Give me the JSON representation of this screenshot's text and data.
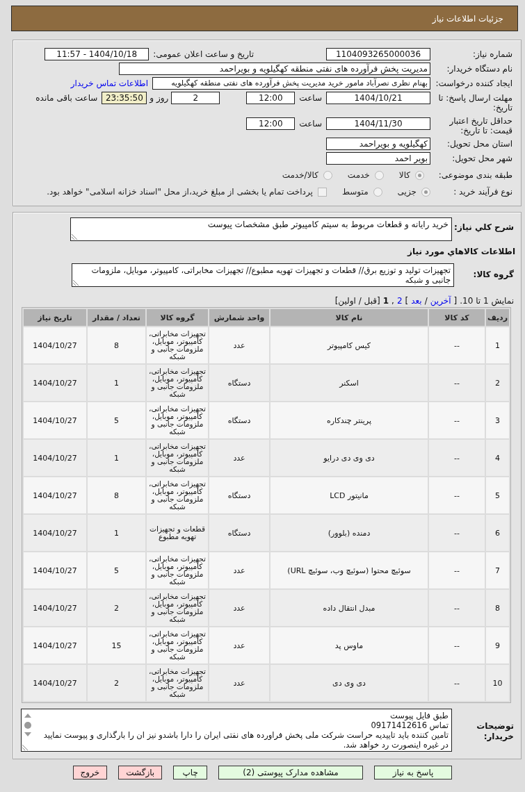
{
  "header": {
    "title": "جزئیات اطلاعات نیاز"
  },
  "details": {
    "need_number": {
      "label": "شماره نیاز:",
      "value": "1104093265000036"
    },
    "announce": {
      "label": "تاریخ و ساعت اعلان عمومی:",
      "value": "1404/10/18 - 11:57"
    },
    "buyer_org": {
      "label": "نام دستگاه خریدار:",
      "value": "مدیریت پخش فرآورده های نفتی منطقه کهگیلویه و بویراحمد"
    },
    "requester": {
      "label": "ایجاد کننده درخواست:",
      "value": "بهنام نظری نصرآباد مامور خرید مدیریت پخش فرآورده های نفتی منطقه کهگیلویه",
      "link": "اطلاعات تماس خریدار"
    },
    "reply_deadline": {
      "label": "مهلت ارسال پاسخ: تا تاریخ:",
      "date": "1404/10/21",
      "time_label": "ساعت",
      "time": "12:00",
      "days": "2",
      "days_label": "روز و",
      "remaining": "23:35:50",
      "remaining_label": "ساعت باقی مانده"
    },
    "price_validity": {
      "label": "حداقل تاریخ اعتبار قیمت: تا تاریخ:",
      "date": "1404/11/30",
      "time_label": "ساعت",
      "time": "12:00"
    },
    "province": {
      "label": "استان محل تحویل:",
      "value": "کهگیلویه و بویراحمد"
    },
    "city": {
      "label": "شهر محل تحویل:",
      "value": "بویر احمد"
    },
    "category": {
      "label": "طبقه بندی موضوعی:",
      "options": [
        {
          "label": "کالا",
          "selected": true
        },
        {
          "label": "خدمت",
          "selected": false
        },
        {
          "label": "کالا/خدمت",
          "selected": false
        }
      ]
    },
    "process": {
      "label": "نوع فرآیند خرید :",
      "options": [
        {
          "label": "جزیی",
          "selected": true
        },
        {
          "label": "متوسط",
          "selected": false
        }
      ],
      "treasury": {
        "checked": false,
        "text": "پرداخت تمام یا بخشی از مبلغ خرید،از محل \"اسناد خزانه اسلامی\" خواهد بود."
      }
    }
  },
  "description": {
    "label": "شرح كلي نياز:",
    "value": "خرید رایانه و قطعات مربوط به سیتم کامپیوتر طبق مشخصات پیوست"
  },
  "goods": {
    "title": "اطلاعات كالاهاي مورد نياز",
    "group_label": "گروه کالا:",
    "group_value": "تجهیزات تولید و توزیع برق// قطعات و تجهیزات تهویه مطبوع// تجهیزات مخابراتی، کامپیوتر، موبایل، ملزومات جانبی و شبکه",
    "pagination": [
      {
        "kind": "text",
        "text": "نمایش 1 تا 10."
      },
      {
        "kind": "text",
        "text": "["
      },
      {
        "kind": "link",
        "text": "آخرین"
      },
      {
        "kind": "text",
        "text": "/"
      },
      {
        "kind": "link",
        "text": "بعد"
      },
      {
        "kind": "text",
        "text": "]"
      },
      {
        "kind": "link",
        "text": "2"
      },
      {
        "kind": "text",
        "text": ","
      },
      {
        "kind": "current",
        "text": "1"
      },
      {
        "kind": "text",
        "text": "[قبل / اولین]"
      }
    ],
    "table": {
      "columns": [
        "ردیف",
        "کد کالا",
        "نام کالا",
        "واحد شمارش",
        "گروه کالا",
        "تعداد / مقدار",
        "تاریخ نیاز"
      ],
      "rows": [
        [
          "1",
          "--",
          "کیس کامپیوتر",
          "عدد",
          "تجهیزات مخابراتی، کامپیوتر، موبایل، ملزومات جانبی و شبکه",
          "8",
          "1404/10/27"
        ],
        [
          "2",
          "--",
          "اسکنر",
          "دستگاه",
          "تجهیزات مخابراتی، کامپیوتر، موبایل، ملزومات جانبی و شبکه",
          "1",
          "1404/10/27"
        ],
        [
          "3",
          "--",
          "پرینتر چندکاره",
          "دستگاه",
          "تجهیزات مخابراتی، کامپیوتر، موبایل، ملزومات جانبی و شبکه",
          "5",
          "1404/10/27"
        ],
        [
          "4",
          "--",
          "دی وی دی درایو",
          "عدد",
          "تجهیزات مخابراتی، کامپیوتر، موبایل، ملزومات جانبی و شبکه",
          "1",
          "1404/10/27"
        ],
        [
          "5",
          "--",
          "مانیتور LCD",
          "دستگاه",
          "تجهیزات مخابراتی، کامپیوتر، موبایل، ملزومات جانبی و شبکه",
          "8",
          "1404/10/27"
        ],
        [
          "6",
          "--",
          "دمنده (بلوور)",
          "دستگاه",
          "قطعات و تجهیزات تهویه مطبوع",
          "1",
          "1404/10/27"
        ],
        [
          "7",
          "--",
          "سوئیچ محتوا (سوئیچ وب، سوئیچ URL)",
          "عدد",
          "تجهیزات مخابراتی، کامپیوتر، موبایل، ملزومات جانبی و شبکه",
          "5",
          "1404/10/27"
        ],
        [
          "8",
          "--",
          "مبدل انتقال داده",
          "عدد",
          "تجهیزات مخابراتی، کامپیوتر، موبایل، ملزومات جانبی و شبکه",
          "2",
          "1404/10/27"
        ],
        [
          "9",
          "--",
          "ماوس پد",
          "عدد",
          "تجهیزات مخابراتی، کامپیوتر، موبایل، ملزومات جانبی و شبکه",
          "15",
          "1404/10/27"
        ],
        [
          "10",
          "--",
          "دی وی دی",
          "عدد",
          "تجهیزات مخابراتی، کامپیوتر، موبایل، ملزومات جانبی و شبکه",
          "2",
          "1404/10/27"
        ]
      ]
    }
  },
  "buyer_notes": {
    "label": "توضیحات خریدار:",
    "value": "طبق فایل پیوست\nتماس 09171412616\nتامین کننده باید تاییدیه حراست شرکت ملی پخش فراورده های نفتی ایران را دارا باشدو نیز ان را بارگذاری و پیوست نمایید در غیره اینصورت رد خواهد شد."
  },
  "buttons": [
    {
      "label": "پاسخ به نیاز",
      "kind": "action"
    },
    {
      "label": "مشاهده مدارک پیوستی (2)",
      "kind": "action"
    },
    {
      "label": "چاپ",
      "kind": "action"
    },
    {
      "label": "بازگشت",
      "kind": "cancel"
    },
    {
      "label": "خروج",
      "kind": "cancel"
    }
  ]
}
